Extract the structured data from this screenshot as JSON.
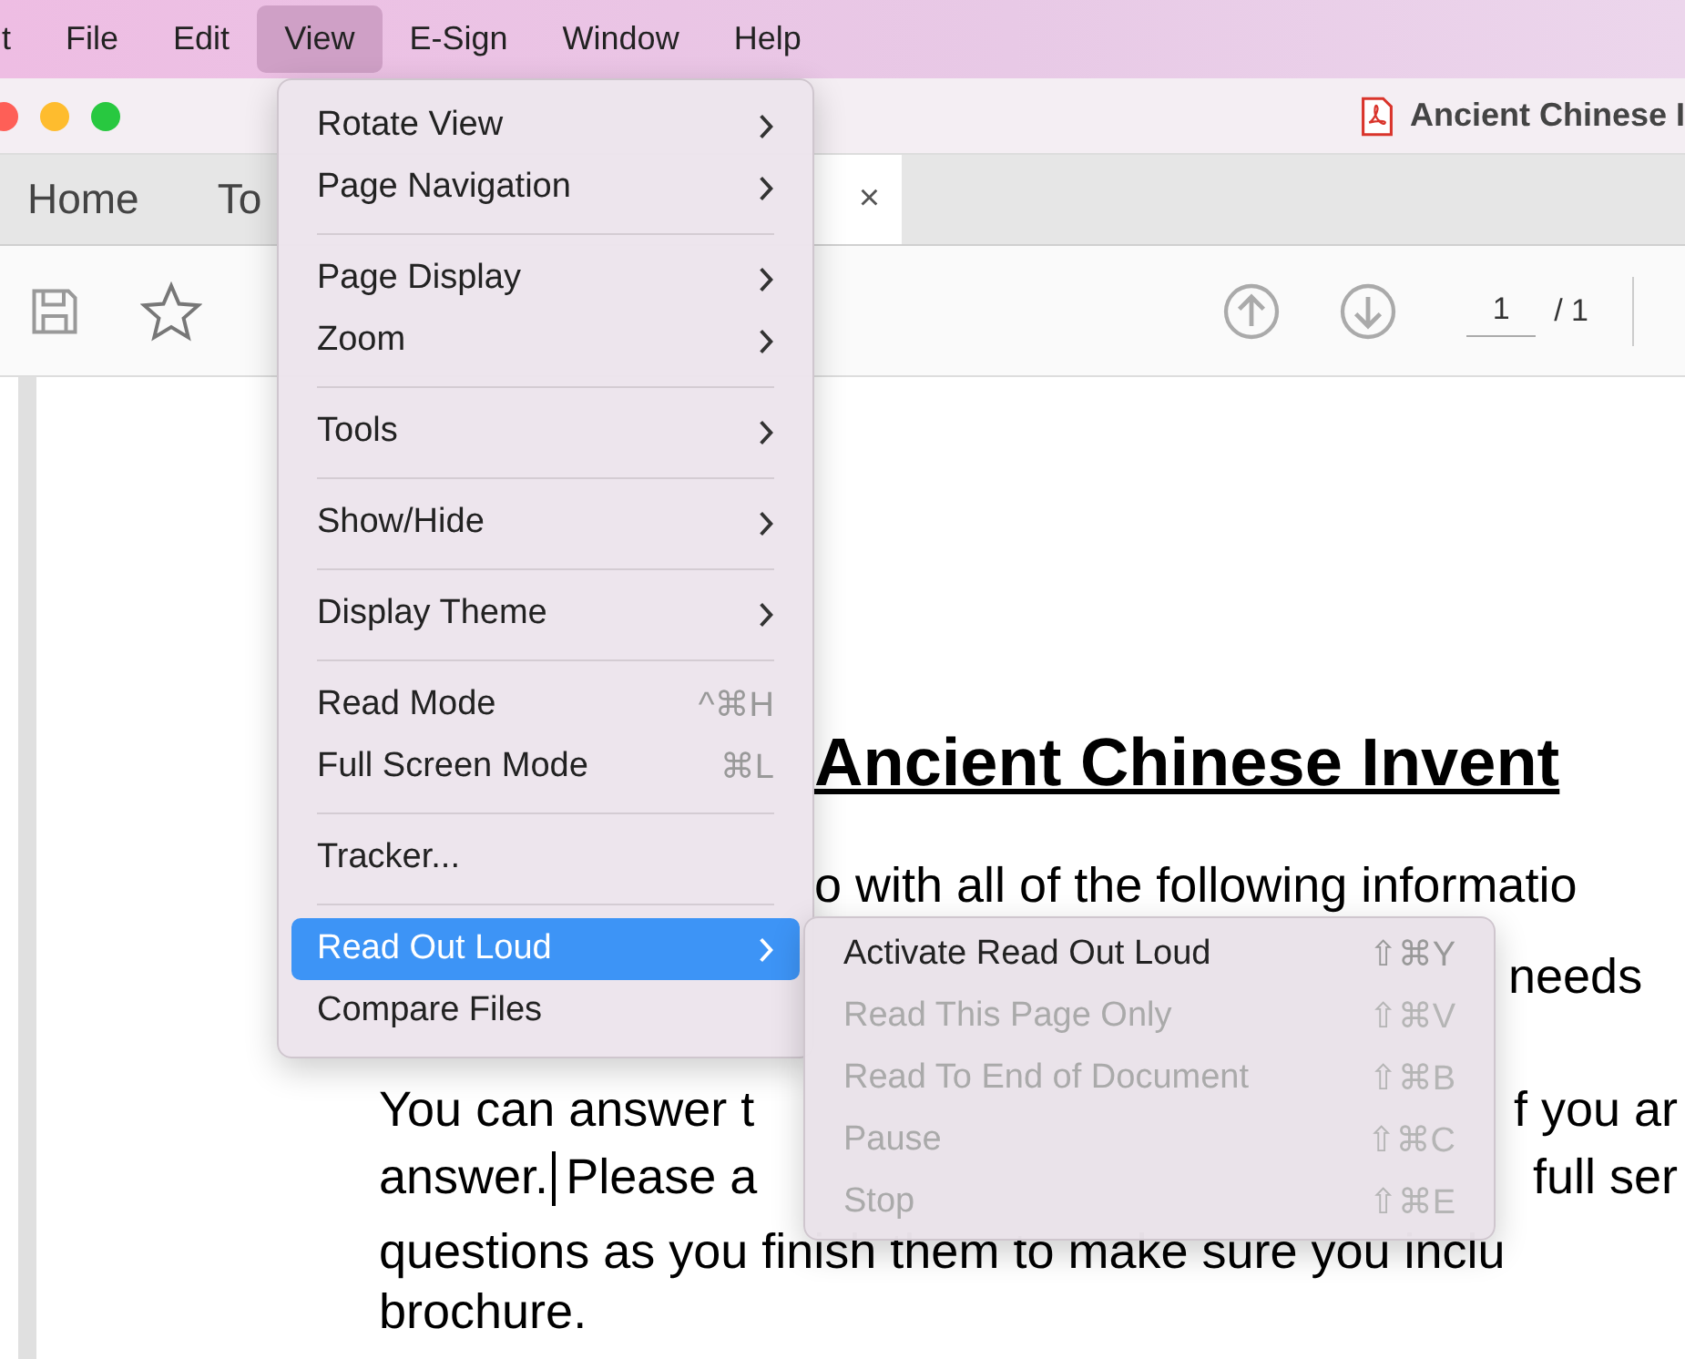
{
  "menu_bar": [
    {
      "label": "t",
      "selected": false
    },
    {
      "label": "File",
      "selected": false
    },
    {
      "label": "Edit",
      "selected": false
    },
    {
      "label": "View",
      "selected": true
    },
    {
      "label": "E-Sign",
      "selected": false
    },
    {
      "label": "Window",
      "selected": false
    },
    {
      "label": "Help",
      "selected": false
    }
  ],
  "window": {
    "title": "Ancient Chinese I"
  },
  "tabs": [
    {
      "label": "Home"
    },
    {
      "label": "To"
    }
  ],
  "document_tab": {
    "close": "×"
  },
  "toolbar": {
    "page_field": "1",
    "page_total": "/ 1"
  },
  "document": {
    "title": "Ancient Chinese Invent",
    "lines": [
      {
        "kind": "top",
        "parts": [
          "o with all of the following informatio"
        ]
      },
      {
        "kind": "right",
        "parts": [
          "needs"
        ]
      },
      {
        "kind": "split",
        "parts": [
          "You can answer t",
          "f you ar"
        ]
      },
      {
        "kind": "caret",
        "parts": [
          "answer.",
          "Please a",
          "full ser"
        ]
      },
      {
        "kind": "full",
        "parts": [
          "questions as you finish them to make sure you inclu"
        ]
      },
      {
        "kind": "full",
        "parts": [
          "brochure."
        ]
      }
    ]
  },
  "view_menu": [
    {
      "kind": "item",
      "label": "Rotate View",
      "submenu": true,
      "selected": false
    },
    {
      "kind": "item",
      "label": "Page Navigation",
      "submenu": true,
      "selected": false
    },
    {
      "kind": "separator"
    },
    {
      "kind": "item",
      "label": "Page Display",
      "submenu": true,
      "selected": false
    },
    {
      "kind": "item",
      "label": "Zoom",
      "submenu": true,
      "selected": false
    },
    {
      "kind": "separator"
    },
    {
      "kind": "item",
      "label": "Tools",
      "submenu": true,
      "selected": false
    },
    {
      "kind": "separator"
    },
    {
      "kind": "item",
      "label": "Show/Hide",
      "submenu": true,
      "selected": false
    },
    {
      "kind": "separator"
    },
    {
      "kind": "item",
      "label": "Display Theme",
      "submenu": true,
      "selected": false
    },
    {
      "kind": "separator"
    },
    {
      "kind": "item",
      "label": "Read Mode",
      "shortcut": "^⌘H",
      "submenu": false,
      "selected": false
    },
    {
      "kind": "item",
      "label": "Full Screen Mode",
      "shortcut": "⌘L",
      "submenu": false,
      "selected": false
    },
    {
      "kind": "separator"
    },
    {
      "kind": "item",
      "label": "Tracker...",
      "submenu": false,
      "selected": false
    },
    {
      "kind": "separator"
    },
    {
      "kind": "item",
      "label": "Read Out Loud",
      "submenu": true,
      "selected": true
    },
    {
      "kind": "item",
      "label": "Compare Files",
      "submenu": false,
      "selected": false
    }
  ],
  "read_out_loud_menu": [
    {
      "label": "Activate Read Out Loud",
      "shortcut": "⇧⌘Y",
      "disabled": false
    },
    {
      "label": "Read This Page Only",
      "shortcut": "⇧⌘V",
      "disabled": true
    },
    {
      "label": "Read To End of Document",
      "shortcut": "⇧⌘B",
      "disabled": true
    },
    {
      "label": "Pause",
      "shortcut": "⇧⌘C",
      "disabled": true
    },
    {
      "label": "Stop",
      "shortcut": "⇧⌘E",
      "disabled": true
    }
  ]
}
